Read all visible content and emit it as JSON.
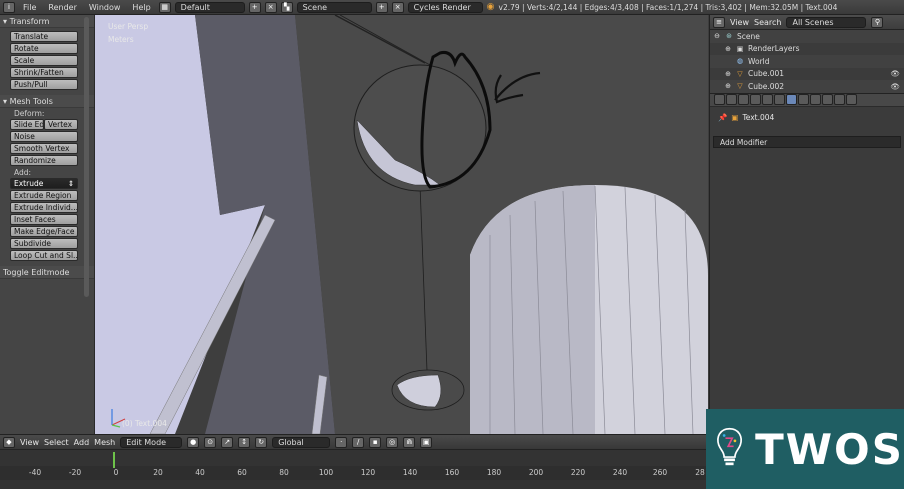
{
  "topbar": {
    "menus": [
      "File",
      "Render",
      "Window",
      "Help"
    ],
    "layout": "Default",
    "scene": "Scene",
    "engine": "Cycles Render",
    "stats": "v2.79 | Verts:4/2,144 | Edges:4/3,408 | Faces:1/1,274 | Tris:3,402 | Mem:32.05M | Text.004"
  },
  "toolshelf": {
    "transform_title": "Transform",
    "transform_tools": [
      "Translate",
      "Rotate",
      "Scale",
      "Shrink/Fatten",
      "Push/Pull"
    ],
    "mesh_tools_title": "Mesh Tools",
    "deform_label": "Deform:",
    "slide_edge": "Slide Ed",
    "vertex": "Vertex",
    "deform_tools": [
      "Noise",
      "Smooth Vertex",
      "Randomize"
    ],
    "add_label": "Add:",
    "extrude": "Extrude",
    "add_tools": [
      "Extrude Region",
      "Extrude Individ...",
      "Inset Faces",
      "Make Edge/Face",
      "Subdivide",
      "Loop Cut and Sl..."
    ],
    "toggle": "Toggle Editmode"
  },
  "viewport": {
    "view_name": "User Persp",
    "units": "Meters",
    "object_label": "(0) Text.004"
  },
  "outliner": {
    "view": "View",
    "search": "Search",
    "filter": "All Scenes",
    "rows": [
      {
        "label": "Scene"
      },
      {
        "label": "RenderLayers"
      },
      {
        "label": "World"
      },
      {
        "label": "Cube.001"
      },
      {
        "label": "Cube.002"
      }
    ]
  },
  "properties": {
    "object_name": "Text.004",
    "add_modifier": "Add Modifier"
  },
  "vp_header": {
    "view": "View",
    "select": "Select",
    "add": "Add",
    "mesh": "Mesh",
    "mode": "Edit Mode",
    "orientation": "Global"
  },
  "timeline": {
    "ticks": [
      "-40",
      "-20",
      "0",
      "20",
      "40",
      "60",
      "80",
      "100",
      "120",
      "140",
      "160",
      "180",
      "200",
      "220",
      "240",
      "260",
      "28"
    ]
  },
  "watermark": {
    "text": "TWOS"
  },
  "colors": {
    "viewport_bg": "#3b3b3b",
    "wall_light": "#c9c9e4",
    "accent_green": "#6ec34a",
    "logo_bg": "#1f5e63"
  }
}
